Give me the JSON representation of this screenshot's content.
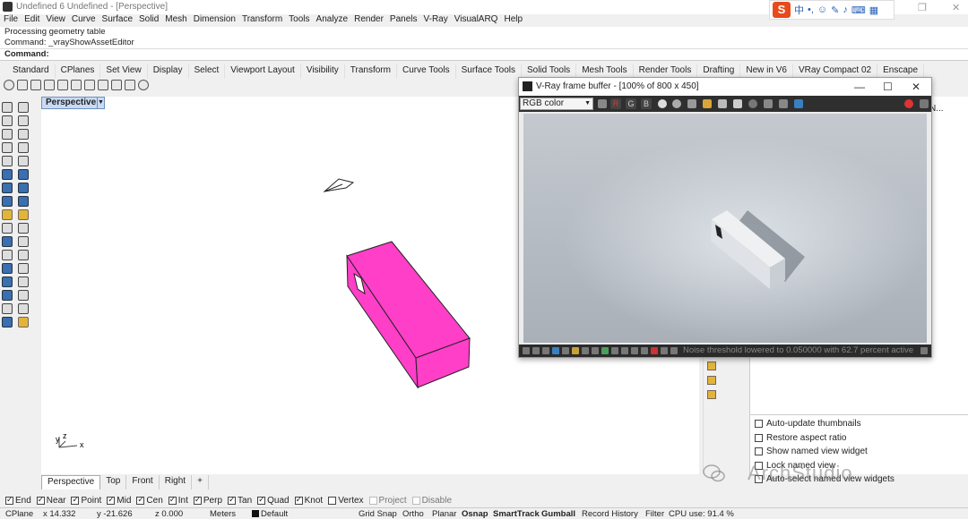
{
  "window": {
    "title": "Undefined 6 Undefined - [Perspective]"
  },
  "ime": {
    "logo": "S",
    "lang": "中"
  },
  "menu": [
    "File",
    "Edit",
    "View",
    "Curve",
    "Surface",
    "Solid",
    "Mesh",
    "Dimension",
    "Transform",
    "Tools",
    "Analyze",
    "Render",
    "Panels",
    "V-Ray",
    "VisualARQ",
    "Help"
  ],
  "command": {
    "history1": "Processing geometry table",
    "history2": "Command: _vrayShowAssetEditor",
    "prompt": "Command:"
  },
  "tabs": [
    "Standard",
    "CPlanes",
    "Set View",
    "Display",
    "Select",
    "Viewport Layout",
    "Visibility",
    "Transform",
    "Curve Tools",
    "Surface Tools",
    "Solid Tools",
    "Mesh Tools",
    "Render Tools",
    "Drafting",
    "New in V6",
    "VRay Compact 02",
    "Enscape"
  ],
  "viewport": {
    "label": "Perspective",
    "axis_y": "y",
    "axis_z": "z",
    "axis_x": "x",
    "object_color": "#ff3fc8"
  },
  "vfb": {
    "title": "V-Ray frame buffer - [100% of 800 x 450]",
    "channel": "RGB color",
    "btn_r": "R",
    "btn_g": "G",
    "btn_b": "B",
    "status": "Noise threshold lowered to 0.050000 with 62.7 percent active"
  },
  "right_panel": {
    "header": "N...",
    "options": [
      {
        "label": "Auto-update thumbnails",
        "checked": false
      },
      {
        "label": "Restore aspect ratio",
        "checked": false
      },
      {
        "label": "Show named view widget",
        "checked": false
      },
      {
        "label": "Lock named view",
        "checked": false
      },
      {
        "label": "Auto-select named view widgets",
        "checked": false
      }
    ]
  },
  "viewport_tabs": [
    "Perspective",
    "Top",
    "Front",
    "Right",
    "+"
  ],
  "osnap": [
    {
      "label": "End",
      "checked": true
    },
    {
      "label": "Near",
      "checked": true
    },
    {
      "label": "Point",
      "checked": true
    },
    {
      "label": "Mid",
      "checked": true
    },
    {
      "label": "Cen",
      "checked": true
    },
    {
      "label": "Int",
      "checked": true
    },
    {
      "label": "Perp",
      "checked": true
    },
    {
      "label": "Tan",
      "checked": true
    },
    {
      "label": "Quad",
      "checked": true
    },
    {
      "label": "Knot",
      "checked": true
    },
    {
      "label": "Vertex",
      "checked": false
    },
    {
      "label": "Project",
      "checked": false,
      "disabled": true
    },
    {
      "label": "Disable",
      "checked": false,
      "disabled": true
    }
  ],
  "statusbar": {
    "cplane": "CPlane",
    "x": "x 14.332",
    "y": "y -21.626",
    "z": "z 0.000",
    "units": "Meters",
    "layer": "Default",
    "grid_snap": "Grid Snap",
    "ortho": "Ortho",
    "planar": "Planar",
    "osnap": "Osnap",
    "smarttrack": "SmartTrack",
    "gumball": "Gumball",
    "record_history": "Record History",
    "filter": "Filter",
    "cpu": "CPU use: 91.4 %"
  },
  "watermark": "ArchStudio"
}
